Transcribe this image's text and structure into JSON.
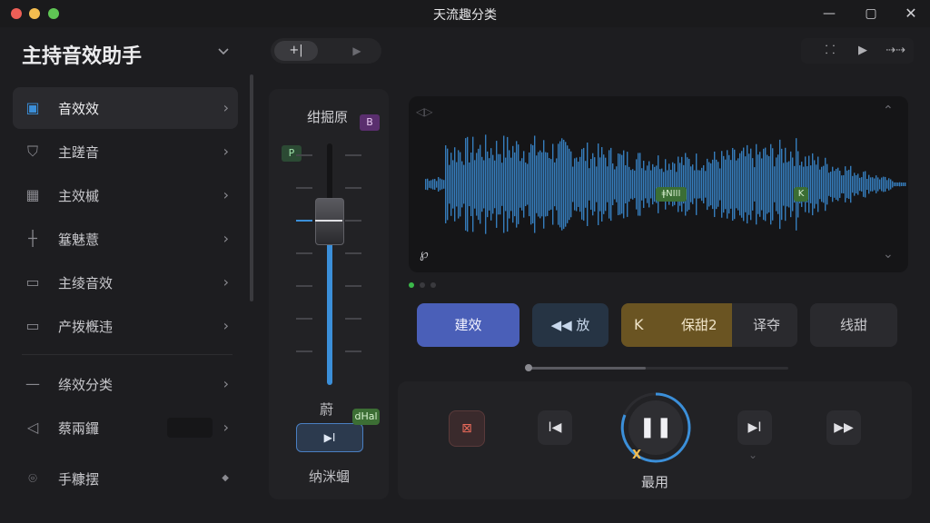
{
  "window": {
    "title": "天流趣分类",
    "min": "—",
    "max": "▢",
    "close": "✕"
  },
  "sidebar": {
    "title": "主持音效助手",
    "items": [
      {
        "label": "音效效",
        "icon": "audio-cube-icon"
      },
      {
        "label": "主蹉音",
        "icon": "shield-star-icon"
      },
      {
        "label": "主效槭",
        "icon": "calendar-icon"
      },
      {
        "label": "簊魅薏",
        "icon": "crosshair-icon"
      },
      {
        "label": "主绫音效",
        "icon": "inbox-icon"
      },
      {
        "label": "产拨槪违",
        "icon": "card-icon"
      },
      {
        "label": "绦效分类",
        "icon": "minus-icon"
      },
      {
        "label": "蔡兩鑼",
        "icon": "megaphone-icon"
      },
      {
        "label": "手糠摆",
        "icon": "location-pin-icon"
      }
    ]
  },
  "toolbar": {
    "seg_active": "+|",
    "seg_next": "▶"
  },
  "mixer": {
    "title": "绀掘原",
    "badge_b": "B",
    "badge_p": "P",
    "mid_label": "蔚",
    "button_label": "▶I",
    "button_tag": "dHal",
    "bottom_label": "纳洣蟈",
    "fader_level": 0.62
  },
  "tools": {
    "t1": "⸬",
    "t2": "▶",
    "t3": "⇢⇢"
  },
  "waveform": {
    "label": "℘",
    "marker1": "ǂNIII",
    "marker2": "K"
  },
  "effects": {
    "primary": "建效",
    "rewind": "◀◀ 放",
    "group_k": "K",
    "group_label": "保甜2",
    "group_right": "译夺",
    "last": "线甜"
  },
  "progress": 0.45,
  "transport": {
    "red": "⊠",
    "prev": "I◀",
    "play": "❚❚",
    "next": "▶I",
    "ff": "▶▶",
    "play_label": "最用",
    "x_mark": "X"
  },
  "colors": {
    "accent_blue": "#3b8fd9",
    "primary_button": "#4a5fb8",
    "gold": "#6a5422"
  }
}
